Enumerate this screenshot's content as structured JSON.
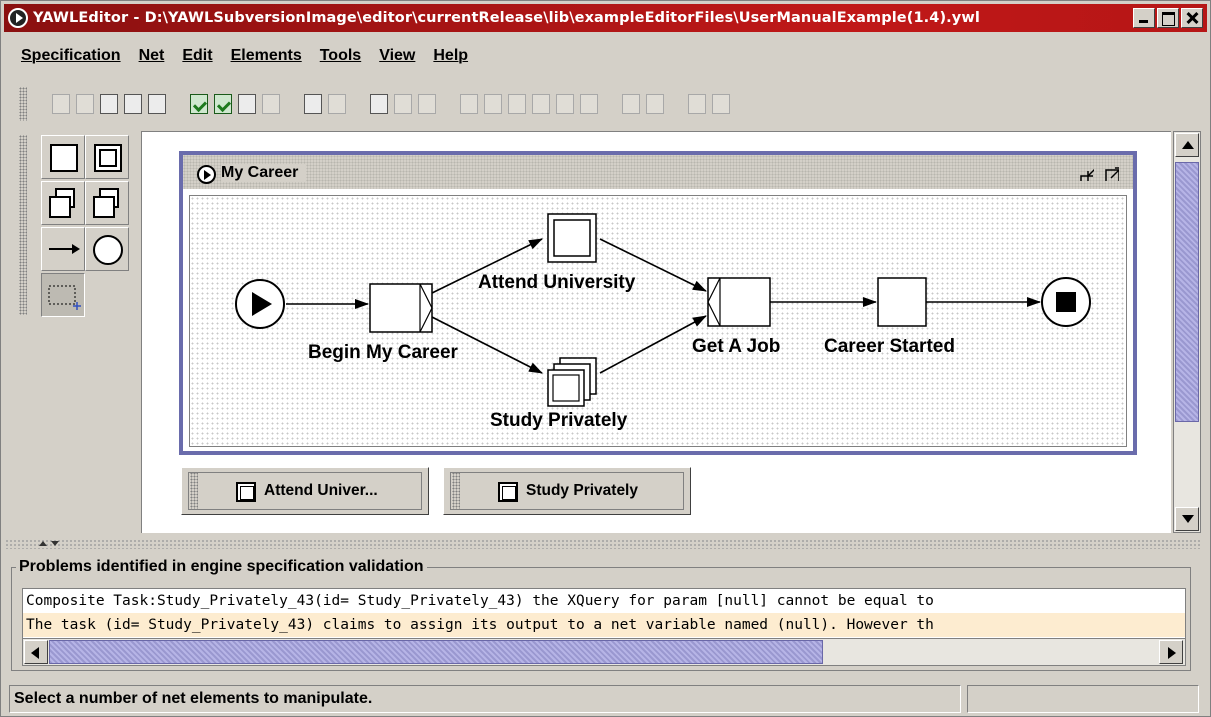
{
  "window": {
    "title": "YAWLEditor - D:\\YAWLSubversionImage\\editor\\currentRelease\\lib\\exampleEditorFiles\\UserManualExample(1.4).ywl"
  },
  "menu": [
    "Specification",
    "Net",
    "Edit",
    "Elements",
    "Tools",
    "View",
    "Help"
  ],
  "net": {
    "title": "My Career",
    "tasks": {
      "begin": "Begin My Career",
      "attend": "Attend University",
      "study": "Study Privately",
      "job": "Get A Job",
      "career": "Career Started"
    }
  },
  "minimized_nets": [
    "Attend Univer...",
    "Study Privately"
  ],
  "problems": {
    "title": "Problems identified in engine specification validation",
    "rows": [
      "Composite Task:Study_Privately_43(id= Study_Privately_43) the XQuery for param [null] cannot be equal to",
      "The task (id= Study_Privately_43) claims to assign its output to a net variable named (null).  However th"
    ]
  },
  "status": "Select a number of net elements to manipulate.",
  "colors": {
    "title_bar": "#c01818",
    "net_border": "#6a6cac",
    "problem_alt_row": "#fdecd0"
  }
}
